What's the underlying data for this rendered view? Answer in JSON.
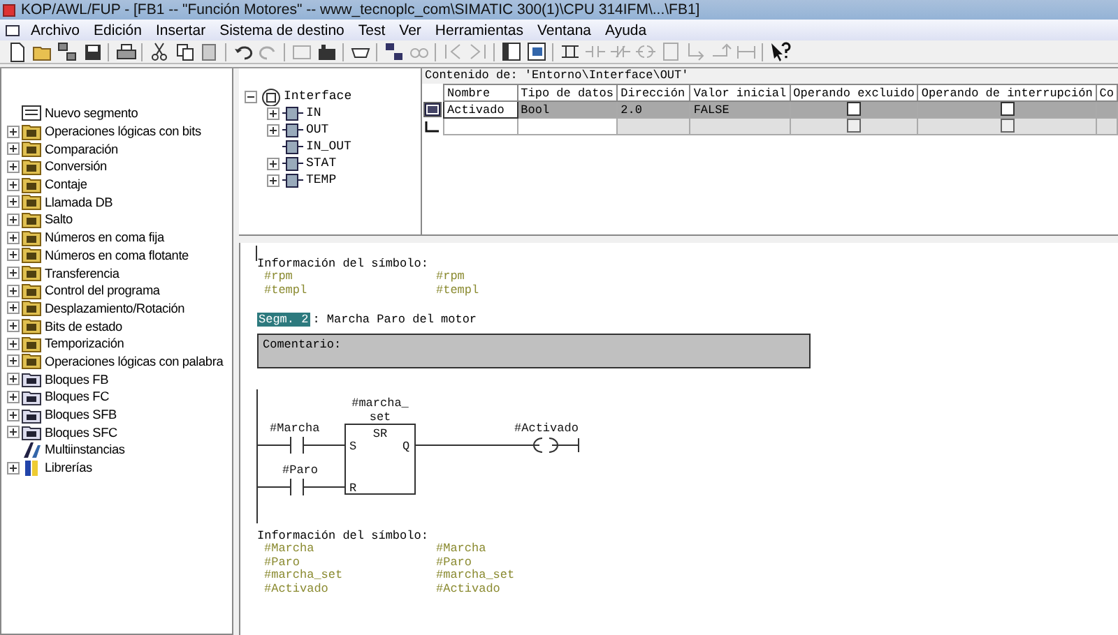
{
  "window": {
    "title": "KOP/AWL/FUP  - [FB1 -- \"Función Motores\" -- www_tecnoplc_com\\SIMATIC 300(1)\\CPU 314IFM\\...\\FB1]"
  },
  "menu": [
    "Archivo",
    "Edición",
    "Insertar",
    "Sistema de destino",
    "Test",
    "Ver",
    "Herramientas",
    "Ventana",
    "Ayuda"
  ],
  "catalog": [
    {
      "label": "Nuevo segmento",
      "kind": "item"
    },
    {
      "label": "Operaciones lógicas con bits",
      "kind": "group"
    },
    {
      "label": "Comparación",
      "kind": "group"
    },
    {
      "label": "Conversión",
      "kind": "group"
    },
    {
      "label": "Contaje",
      "kind": "group"
    },
    {
      "label": "Llamada DB",
      "kind": "group"
    },
    {
      "label": "Salto",
      "kind": "group"
    },
    {
      "label": "Números en coma fija",
      "kind": "group"
    },
    {
      "label": "Números en coma flotante",
      "kind": "group"
    },
    {
      "label": "Transferencia",
      "kind": "group"
    },
    {
      "label": "Control del programa",
      "kind": "group"
    },
    {
      "label": "Desplazamiento/Rotación",
      "kind": "group"
    },
    {
      "label": "Bits de estado",
      "kind": "group"
    },
    {
      "label": "Temporización",
      "kind": "group"
    },
    {
      "label": "Operaciones lógicas con palabra",
      "kind": "group"
    },
    {
      "label": "Bloques FB",
      "kind": "block"
    },
    {
      "label": "Bloques FC",
      "kind": "block"
    },
    {
      "label": "Bloques SFB",
      "kind": "block"
    },
    {
      "label": "Bloques SFC",
      "kind": "block"
    },
    {
      "label": "Multiinstancias",
      "kind": "multi"
    },
    {
      "label": "Librerías",
      "kind": "library"
    }
  ],
  "interface_tree": {
    "label": "Interface",
    "expanded": true,
    "children": [
      {
        "label": "IN",
        "expanded": false
      },
      {
        "label": "OUT",
        "expanded": false
      },
      {
        "label": "IN_OUT"
      },
      {
        "label": "STAT",
        "expanded": false
      },
      {
        "label": "TEMP",
        "expanded": false
      }
    ]
  },
  "table": {
    "caption": "Contenido de: 'Entorno\\Interface\\OUT'",
    "columns": [
      "Nombre",
      "Tipo de datos",
      "Dirección",
      "Valor inicial",
      "Operando excluido",
      "Operando de interrupción",
      "Co"
    ],
    "rows": [
      {
        "selected": true,
        "name": "Activado",
        "type": "Bool",
        "address": "2.0",
        "initial": "FALSE",
        "excluded": false,
        "interrupt": false
      },
      {
        "selected": false,
        "excluded": false,
        "interrupt": false
      }
    ]
  },
  "editor": {
    "symbols_before": {
      "title": "Información del símbolo:",
      "rows": [
        [
          "#rpm",
          "#rpm"
        ],
        [
          "#templ",
          "#templ"
        ]
      ]
    },
    "segment": {
      "number": "Segm. 2",
      "separator": ":",
      "title": "Marcha Paro del motor",
      "comment": "Comentario:"
    },
    "ladder": {
      "contacts": [
        "#Marcha",
        "#Paro"
      ],
      "block_name": [
        "#marcha_",
        "set"
      ],
      "block_type": "SR",
      "inputs": [
        "S",
        "R"
      ],
      "output": "Q",
      "coil": "#Activado"
    },
    "symbols_after": {
      "title": "Información del símbolo:",
      "rows": [
        [
          "#Marcha",
          "#Marcha"
        ],
        [
          "#Paro",
          "#Paro"
        ],
        [
          "#marcha_set",
          "#marcha_set"
        ],
        [
          "#Activado",
          "#Activado"
        ]
      ]
    }
  }
}
